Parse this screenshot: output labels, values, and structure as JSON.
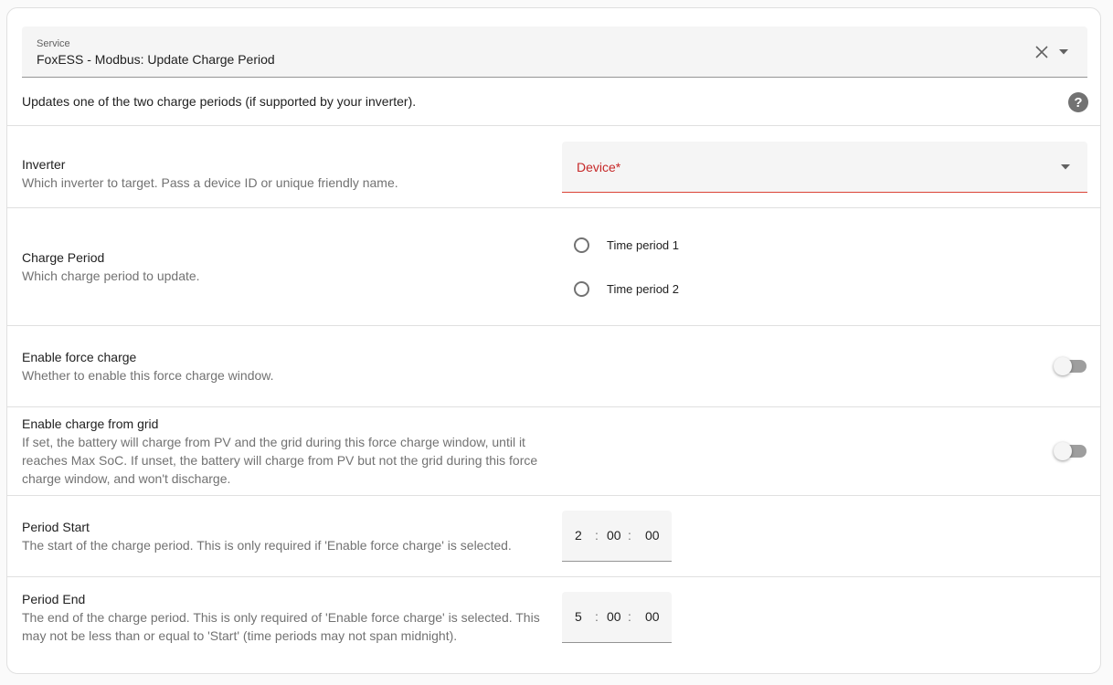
{
  "service": {
    "label": "Service",
    "value": "FoxESS - Modbus: Update Charge Period",
    "description": "Updates one of the two charge periods (if supported by your inverter).",
    "help_glyph": "?",
    "clear_glyph": "✕"
  },
  "inverter": {
    "title": "Inverter",
    "description": "Which inverter to target. Pass a device ID or unique friendly name.",
    "device_label": "Device*"
  },
  "charge_period": {
    "title": "Charge Period",
    "description": "Which charge period to update.",
    "options": [
      "Time period 1",
      "Time period 2"
    ]
  },
  "force_charge": {
    "title": "Enable force charge",
    "description": "Whether to enable this force charge window.",
    "enabled": false
  },
  "charge_from_grid": {
    "title": "Enable charge from grid",
    "description": "If set, the battery will charge from PV and the grid during this force charge window, until it reaches Max SoC. If unset, the battery will charge from PV but not the grid during this force charge window, and won't discharge.",
    "enabled": false
  },
  "period_start": {
    "title": "Period Start",
    "description": "The start of the charge period. This is only required if 'Enable force charge' is selected.",
    "hours": "2",
    "minutes": "00",
    "seconds": "00"
  },
  "period_end": {
    "title": "Period End",
    "description": "The end of the charge period. This is only required of 'Enable force charge' is selected. This may not be less than or equal to 'Start' (time periods may not span midnight).",
    "hours": "5",
    "minutes": "00",
    "seconds": "00"
  },
  "time_separator": ":",
  "colors": {
    "error": "#db4437",
    "field_bg": "#f5f5f5",
    "secondary_text": "#727272"
  }
}
